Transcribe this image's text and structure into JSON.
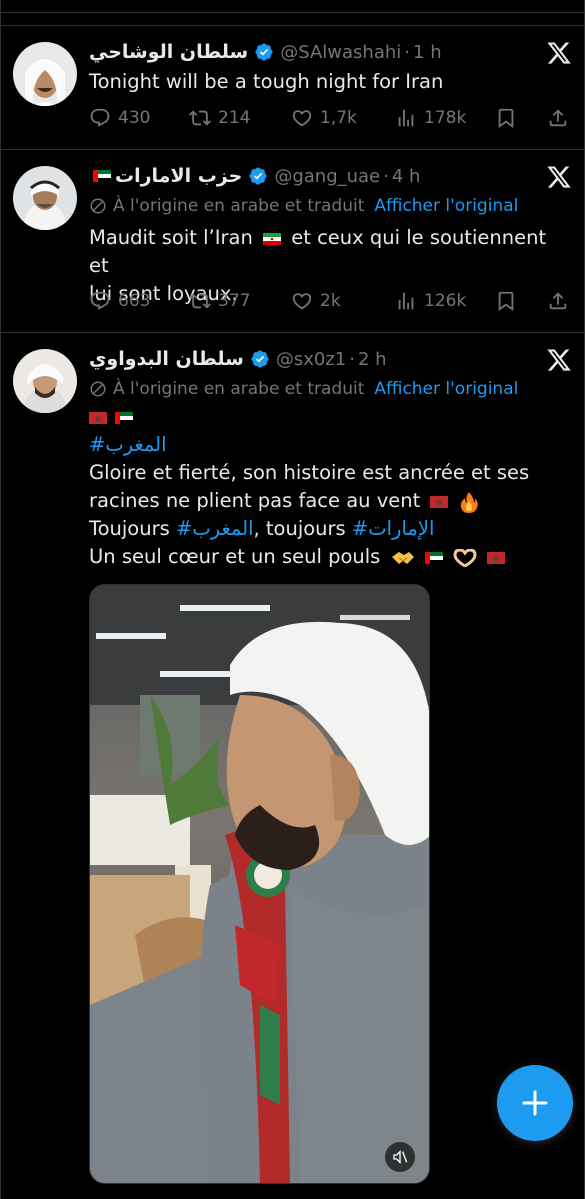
{
  "colors": {
    "accent": "#1d9bf0",
    "muted": "#71767b",
    "text": "#e7e9ea",
    "background": "#000000"
  },
  "tweets": [
    {
      "name": "سلطان الوشاحي",
      "handle": "@SAlwashahi",
      "time": "1 h",
      "text": "Tonight will be a tough night for Iran",
      "replies": "430",
      "retweets": "214",
      "likes": "1,7k",
      "views": "178k"
    },
    {
      "name": "حزب الامارات",
      "handle": "@gang_uae",
      "time": "4 h",
      "translation_note": "À l'origine en arabe et traduit",
      "translation_link": "Afficher l'original",
      "text_line1_a": "Maudit soit l’Iran",
      "text_line1_b": "et ceux qui le soutiennent et",
      "text_line2": "lui sont loyaux.",
      "replies": "663",
      "retweets": "377",
      "likes": "2k",
      "views": "126k"
    },
    {
      "name": "سلطان البدواوي",
      "handle": "@sx0z1",
      "time": "2 h",
      "translation_note": "À l'origine en arabe et traduit",
      "translation_link": "Afficher l'original",
      "hashtag1": "#المغرب",
      "line2": "Gloire et fierté, son histoire est ancrée et ses",
      "line3": "racines ne plient pas face au vent",
      "line4_a": "Toujours",
      "line4_hashtag1": "#المغرب",
      "line4_b": ", toujours",
      "line4_hashtag2": "#الإمارات",
      "line5": "Un seul cœur et un seul pouls"
    }
  ],
  "icons": [
    "reply-icon",
    "retweet-icon",
    "like-icon",
    "views-icon",
    "bookmark-icon",
    "share-icon",
    "x-logo-icon",
    "verified-icon",
    "globe-icon",
    "mute-icon",
    "compose-plus-icon"
  ]
}
